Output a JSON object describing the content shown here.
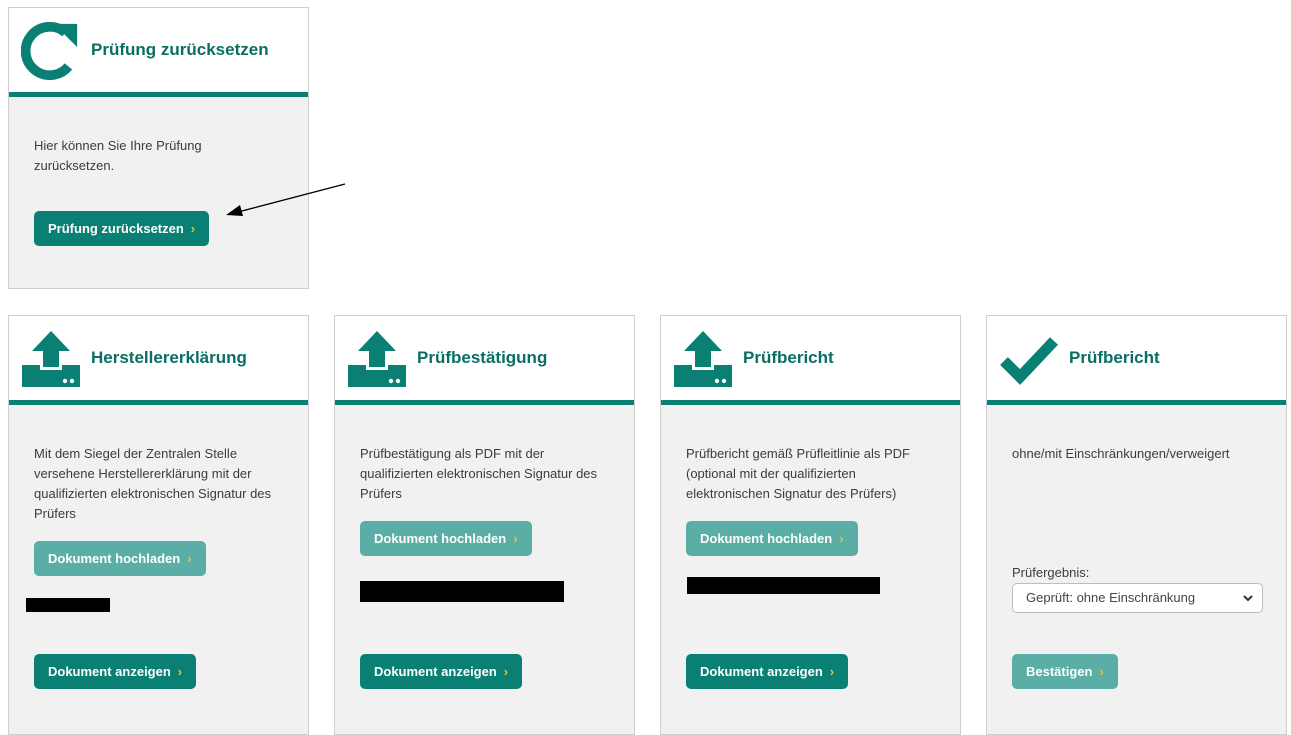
{
  "colors": {
    "accent": "#0a7f73",
    "button_light": "#5aaea6",
    "chevron": "#f2c230",
    "card_bg": "#f1f1f1"
  },
  "reset_card": {
    "icon": "reset-arrow-icon",
    "title": "Prüfung zurücksetzen",
    "description": "Hier können Sie Ihre Prüfung zurücksetzen.",
    "button_label": "Prüfung zurücksetzen"
  },
  "cards": [
    {
      "icon": "upload-icon",
      "title": "Herstellererklärung",
      "description": "Mit dem Siegel der Zentralen Stelle versehene Herstellererklärung mit der qualifizierten elektronischen Signatur des Prüfers",
      "upload_label": "Dokument hochladen",
      "view_label": "Dokument anzeigen"
    },
    {
      "icon": "upload-icon",
      "title": "Prüfbestätigung",
      "description": "Prüfbestätigung als PDF mit der qualifizierten elektronischen Signatur des Prüfers",
      "upload_label": "Dokument hochladen",
      "view_label": "Dokument anzeigen"
    },
    {
      "icon": "upload-icon",
      "title": "Prüfbericht",
      "description": "Prüfbericht gemäß Prüfleitlinie als PDF (optional mit der qualifizierten elektronischen Signatur des Prüfers)",
      "upload_label": "Dokument hochladen",
      "view_label": "Dokument anzeigen"
    },
    {
      "icon": "checkmark-icon",
      "title": "Prüfbericht",
      "description": "ohne/mit Einschränkungen/verweigert",
      "result_label": "Prüfergebnis:",
      "result_value": "Geprüft: ohne Einschränkung",
      "confirm_label": "Bestätigen"
    }
  ],
  "chevron_glyph": "›"
}
